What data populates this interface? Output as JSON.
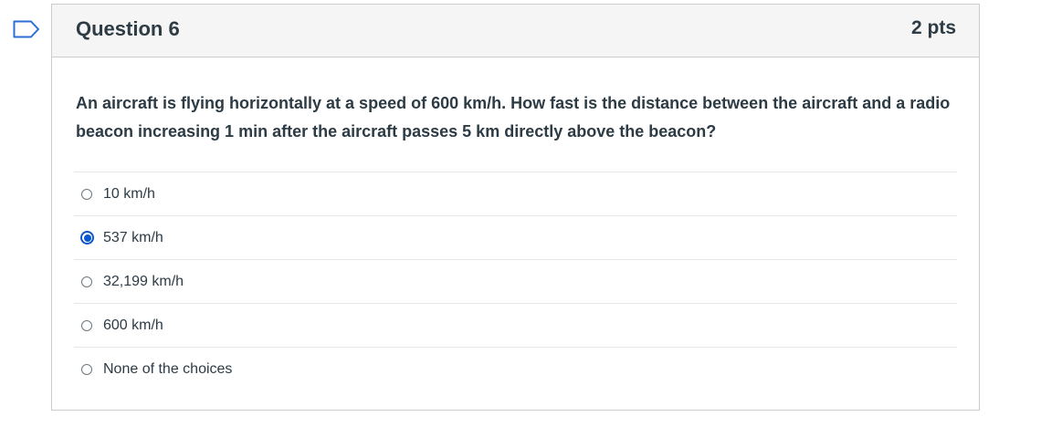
{
  "question": {
    "title": "Question 6",
    "points": "2 pts",
    "text": "An aircraft is flying horizontally at a speed of 600 km/h.  How fast is the distance between the aircraft and a radio beacon increasing 1 min after the aircraft passes 5 km directly above the beacon?",
    "flag_icon": "flag-outline-icon",
    "accent_color": "#0b57d0"
  },
  "answers": [
    {
      "label": "10 km/h",
      "selected": false
    },
    {
      "label": "537 km/h",
      "selected": true
    },
    {
      "label": "32,199 km/h",
      "selected": false
    },
    {
      "label": "600 km/h",
      "selected": false
    },
    {
      "label": "None of the choices",
      "selected": false
    }
  ]
}
